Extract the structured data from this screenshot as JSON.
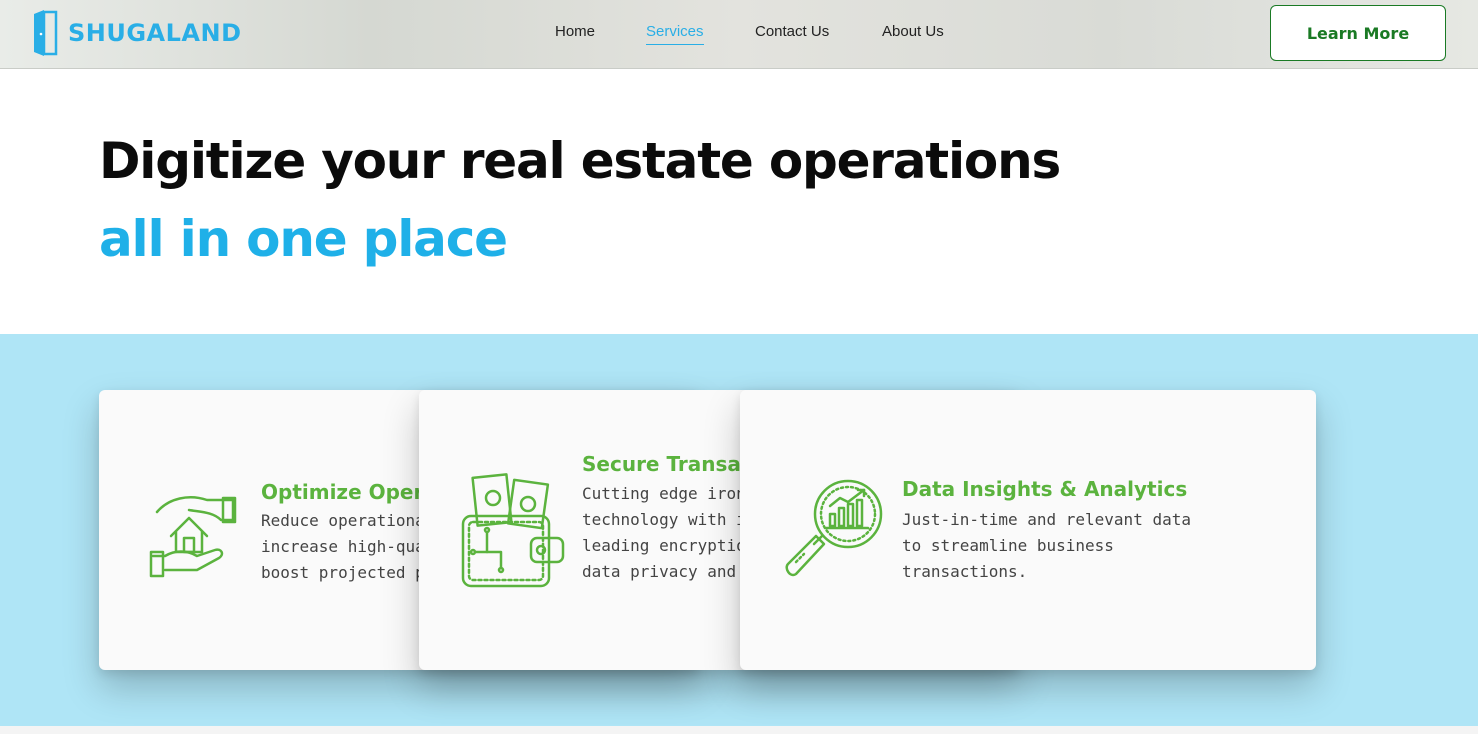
{
  "brand": {
    "name": "SHUGALAND",
    "color": "#29aee6"
  },
  "nav": {
    "items": [
      {
        "label": "Home",
        "active": false
      },
      {
        "label": "Services",
        "active": true
      },
      {
        "label": "Contact Us",
        "active": false
      },
      {
        "label": "About Us",
        "active": false
      }
    ],
    "cta_label": "Learn More"
  },
  "hero": {
    "title": "Digitize your real estate operations",
    "subtitle": "all in one place"
  },
  "features": [
    {
      "icon": "hand-house-icon",
      "title": "Optimize Operations",
      "description": "Reduce operational costs, increase high-quality leads and boost projected profits."
    },
    {
      "icon": "wallet-money-icon",
      "title": "Secure Transactions",
      "description": "Cutting edge ironclad technology with industry leading encryption to guarantee data privacy and compliance."
    },
    {
      "icon": "magnifier-chart-icon",
      "title": "Data Insights & Analytics",
      "description": "Just-in-time and relevant data to streamline business transactions."
    }
  ],
  "colors": {
    "accent_blue": "#1fb0e8",
    "feature_green": "#5bb33e",
    "cta_green": "#1a7a24",
    "band_background": "#afe5f6"
  }
}
